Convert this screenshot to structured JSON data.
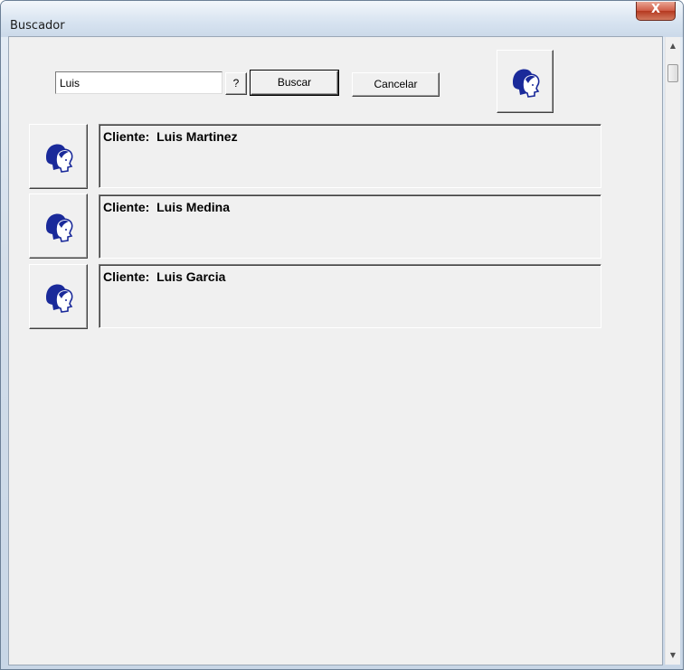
{
  "window": {
    "title": "Buscador",
    "close_label": "X"
  },
  "search": {
    "value": "Luis",
    "help_label": "?",
    "buscar_label": "Buscar",
    "cancelar_label": "Cancelar",
    "icon": "people-icon"
  },
  "results": [
    {
      "text": "Cliente:  Luis Martinez",
      "icon": "people-icon"
    },
    {
      "text": "Cliente:  Luis Medina",
      "icon": "people-icon"
    },
    {
      "text": "Cliente:  Luis Garcia",
      "icon": "people-icon"
    }
  ],
  "scrollbar": {
    "up_arrow": "▲",
    "down_arrow": "▼"
  },
  "colors": {
    "icon_blue": "#1a2a9a",
    "close_red": "#c8442c"
  }
}
